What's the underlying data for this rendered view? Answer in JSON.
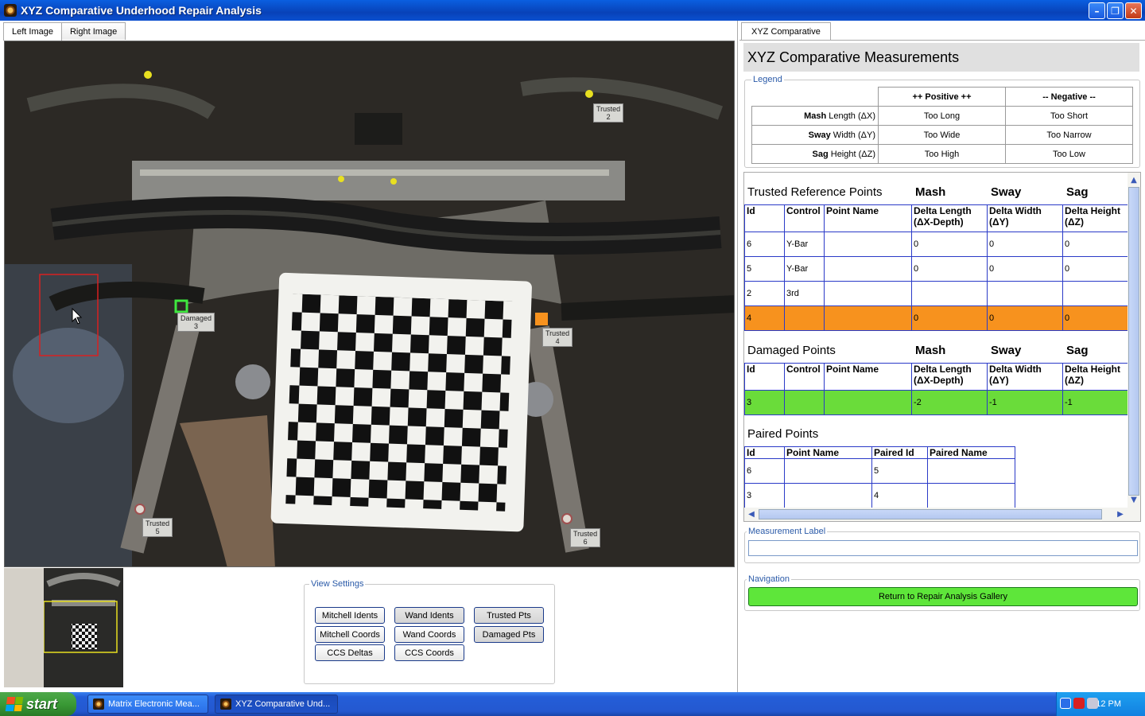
{
  "window": {
    "title": "XYZ Comparative Underhood Repair Analysis"
  },
  "left_tabs": [
    "Left Image",
    "Right Image"
  ],
  "photo_labels": {
    "trusted2": [
      "Trusted",
      "2"
    ],
    "damaged3": [
      "Damaged",
      "3"
    ],
    "trusted4": [
      "Trusted",
      "4"
    ],
    "trusted5": [
      "Trusted",
      "5"
    ],
    "trusted6": [
      "Trusted",
      "6"
    ]
  },
  "view_settings": {
    "legend": "View Settings",
    "buttons": {
      "mitchell_idents": "Mitchell Idents",
      "wand_idents": "Wand Idents",
      "trusted_pts": "Trusted Pts",
      "mitchell_coords": "Mitchell Coords",
      "wand_coords": "Wand Coords",
      "damaged_pts": "Damaged Pts",
      "ccs_deltas": "CCS Deltas",
      "ccs_coords": "CCS Coords"
    }
  },
  "right_tab": "XYZ Comparative",
  "header": "XYZ Comparative Measurements",
  "legend": {
    "title": "Legend",
    "positive": "++ Positive ++",
    "negative": "-- Negative --",
    "rows": [
      {
        "bold": "Mash",
        "rest": " Length (ΔX)",
        "pos": "Too Long",
        "neg": "Too Short"
      },
      {
        "bold": "Sway",
        "rest": " Width (ΔY)",
        "pos": "Too Wide",
        "neg": "Too Narrow"
      },
      {
        "bold": "Sag",
        "rest": " Height (ΔZ)",
        "pos": "Too High",
        "neg": "Too Low"
      }
    ]
  },
  "col_heads": {
    "mash": "Mash",
    "sway": "Sway",
    "sag": "Sag"
  },
  "table_headers": {
    "id": "Id",
    "control": "Control",
    "point_name": "Point Name",
    "delta_length": "Delta Length",
    "delta_length2": "(ΔX-Depth)",
    "delta_width": "Delta Width",
    "delta_width2": "(ΔY)",
    "delta_height": "Delta Height",
    "delta_height2": "(ΔZ)"
  },
  "trusted": {
    "title": "Trusted Reference Points",
    "rows": [
      {
        "id": "6",
        "control": "Y-Bar",
        "name": "",
        "dx": "0",
        "dy": "0",
        "dz": "0"
      },
      {
        "id": "5",
        "control": "Y-Bar",
        "name": "",
        "dx": "0",
        "dy": "0",
        "dz": "0"
      },
      {
        "id": "2",
        "control": "3rd",
        "name": "",
        "dx": "",
        "dy": "",
        "dz": ""
      },
      {
        "id": "4",
        "control": "",
        "name": "",
        "dx": "0",
        "dy": "0",
        "dz": "0"
      }
    ]
  },
  "damaged": {
    "title": "Damaged Points",
    "rows": [
      {
        "id": "3",
        "control": "",
        "name": "",
        "dx": "-2",
        "dy": "-1",
        "dz": "-1"
      }
    ]
  },
  "paired": {
    "title": "Paired Points",
    "headers": {
      "id": "Id",
      "point_name": "Point Name",
      "paired_id": "Paired Id",
      "paired_name": "Paired Name"
    },
    "rows": [
      {
        "id": "6",
        "name": "",
        "paired_id": "5",
        "paired_name": ""
      },
      {
        "id": "3",
        "name": "",
        "paired_id": "4",
        "paired_name": ""
      }
    ]
  },
  "measurement_label": {
    "title": "Measurement Label",
    "value": ""
  },
  "navigation": {
    "title": "Navigation",
    "button": "Return to Repair Analysis Gallery"
  },
  "taskbar": {
    "start": "start",
    "tasks": [
      "Matrix Electronic Mea...",
      "XYZ Comparative Und..."
    ],
    "clock": "4:12 PM"
  },
  "colors": {
    "orange_row": "#f7921e",
    "green_row": "#6adc3a",
    "nav_button": "#5ee63a"
  }
}
